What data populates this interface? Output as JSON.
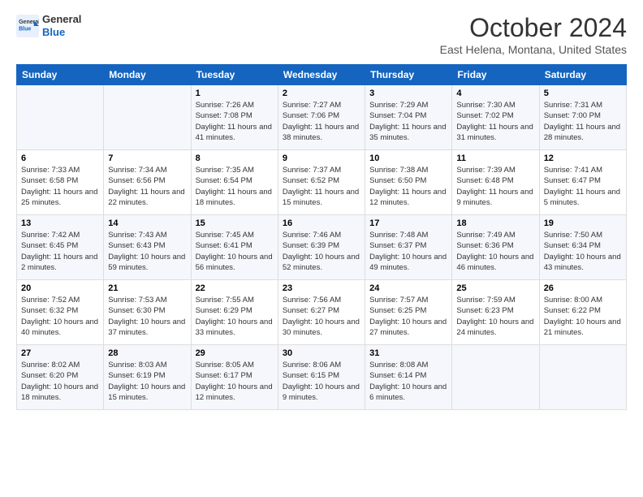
{
  "logo": {
    "line1": "General",
    "line2": "Blue"
  },
  "title": "October 2024",
  "location": "East Helena, Montana, United States",
  "days_header": [
    "Sunday",
    "Monday",
    "Tuesday",
    "Wednesday",
    "Thursday",
    "Friday",
    "Saturday"
  ],
  "weeks": [
    [
      {
        "day": "",
        "sunrise": "",
        "sunset": "",
        "daylight": ""
      },
      {
        "day": "",
        "sunrise": "",
        "sunset": "",
        "daylight": ""
      },
      {
        "day": "1",
        "sunrise": "Sunrise: 7:26 AM",
        "sunset": "Sunset: 7:08 PM",
        "daylight": "Daylight: 11 hours and 41 minutes."
      },
      {
        "day": "2",
        "sunrise": "Sunrise: 7:27 AM",
        "sunset": "Sunset: 7:06 PM",
        "daylight": "Daylight: 11 hours and 38 minutes."
      },
      {
        "day": "3",
        "sunrise": "Sunrise: 7:29 AM",
        "sunset": "Sunset: 7:04 PM",
        "daylight": "Daylight: 11 hours and 35 minutes."
      },
      {
        "day": "4",
        "sunrise": "Sunrise: 7:30 AM",
        "sunset": "Sunset: 7:02 PM",
        "daylight": "Daylight: 11 hours and 31 minutes."
      },
      {
        "day": "5",
        "sunrise": "Sunrise: 7:31 AM",
        "sunset": "Sunset: 7:00 PM",
        "daylight": "Daylight: 11 hours and 28 minutes."
      }
    ],
    [
      {
        "day": "6",
        "sunrise": "Sunrise: 7:33 AM",
        "sunset": "Sunset: 6:58 PM",
        "daylight": "Daylight: 11 hours and 25 minutes."
      },
      {
        "day": "7",
        "sunrise": "Sunrise: 7:34 AM",
        "sunset": "Sunset: 6:56 PM",
        "daylight": "Daylight: 11 hours and 22 minutes."
      },
      {
        "day": "8",
        "sunrise": "Sunrise: 7:35 AM",
        "sunset": "Sunset: 6:54 PM",
        "daylight": "Daylight: 11 hours and 18 minutes."
      },
      {
        "day": "9",
        "sunrise": "Sunrise: 7:37 AM",
        "sunset": "Sunset: 6:52 PM",
        "daylight": "Daylight: 11 hours and 15 minutes."
      },
      {
        "day": "10",
        "sunrise": "Sunrise: 7:38 AM",
        "sunset": "Sunset: 6:50 PM",
        "daylight": "Daylight: 11 hours and 12 minutes."
      },
      {
        "day": "11",
        "sunrise": "Sunrise: 7:39 AM",
        "sunset": "Sunset: 6:48 PM",
        "daylight": "Daylight: 11 hours and 9 minutes."
      },
      {
        "day": "12",
        "sunrise": "Sunrise: 7:41 AM",
        "sunset": "Sunset: 6:47 PM",
        "daylight": "Daylight: 11 hours and 5 minutes."
      }
    ],
    [
      {
        "day": "13",
        "sunrise": "Sunrise: 7:42 AM",
        "sunset": "Sunset: 6:45 PM",
        "daylight": "Daylight: 11 hours and 2 minutes."
      },
      {
        "day": "14",
        "sunrise": "Sunrise: 7:43 AM",
        "sunset": "Sunset: 6:43 PM",
        "daylight": "Daylight: 10 hours and 59 minutes."
      },
      {
        "day": "15",
        "sunrise": "Sunrise: 7:45 AM",
        "sunset": "Sunset: 6:41 PM",
        "daylight": "Daylight: 10 hours and 56 minutes."
      },
      {
        "day": "16",
        "sunrise": "Sunrise: 7:46 AM",
        "sunset": "Sunset: 6:39 PM",
        "daylight": "Daylight: 10 hours and 52 minutes."
      },
      {
        "day": "17",
        "sunrise": "Sunrise: 7:48 AM",
        "sunset": "Sunset: 6:37 PM",
        "daylight": "Daylight: 10 hours and 49 minutes."
      },
      {
        "day": "18",
        "sunrise": "Sunrise: 7:49 AM",
        "sunset": "Sunset: 6:36 PM",
        "daylight": "Daylight: 10 hours and 46 minutes."
      },
      {
        "day": "19",
        "sunrise": "Sunrise: 7:50 AM",
        "sunset": "Sunset: 6:34 PM",
        "daylight": "Daylight: 10 hours and 43 minutes."
      }
    ],
    [
      {
        "day": "20",
        "sunrise": "Sunrise: 7:52 AM",
        "sunset": "Sunset: 6:32 PM",
        "daylight": "Daylight: 10 hours and 40 minutes."
      },
      {
        "day": "21",
        "sunrise": "Sunrise: 7:53 AM",
        "sunset": "Sunset: 6:30 PM",
        "daylight": "Daylight: 10 hours and 37 minutes."
      },
      {
        "day": "22",
        "sunrise": "Sunrise: 7:55 AM",
        "sunset": "Sunset: 6:29 PM",
        "daylight": "Daylight: 10 hours and 33 minutes."
      },
      {
        "day": "23",
        "sunrise": "Sunrise: 7:56 AM",
        "sunset": "Sunset: 6:27 PM",
        "daylight": "Daylight: 10 hours and 30 minutes."
      },
      {
        "day": "24",
        "sunrise": "Sunrise: 7:57 AM",
        "sunset": "Sunset: 6:25 PM",
        "daylight": "Daylight: 10 hours and 27 minutes."
      },
      {
        "day": "25",
        "sunrise": "Sunrise: 7:59 AM",
        "sunset": "Sunset: 6:23 PM",
        "daylight": "Daylight: 10 hours and 24 minutes."
      },
      {
        "day": "26",
        "sunrise": "Sunrise: 8:00 AM",
        "sunset": "Sunset: 6:22 PM",
        "daylight": "Daylight: 10 hours and 21 minutes."
      }
    ],
    [
      {
        "day": "27",
        "sunrise": "Sunrise: 8:02 AM",
        "sunset": "Sunset: 6:20 PM",
        "daylight": "Daylight: 10 hours and 18 minutes."
      },
      {
        "day": "28",
        "sunrise": "Sunrise: 8:03 AM",
        "sunset": "Sunset: 6:19 PM",
        "daylight": "Daylight: 10 hours and 15 minutes."
      },
      {
        "day": "29",
        "sunrise": "Sunrise: 8:05 AM",
        "sunset": "Sunset: 6:17 PM",
        "daylight": "Daylight: 10 hours and 12 minutes."
      },
      {
        "day": "30",
        "sunrise": "Sunrise: 8:06 AM",
        "sunset": "Sunset: 6:15 PM",
        "daylight": "Daylight: 10 hours and 9 minutes."
      },
      {
        "day": "31",
        "sunrise": "Sunrise: 8:08 AM",
        "sunset": "Sunset: 6:14 PM",
        "daylight": "Daylight: 10 hours and 6 minutes."
      },
      {
        "day": "",
        "sunrise": "",
        "sunset": "",
        "daylight": ""
      },
      {
        "day": "",
        "sunrise": "",
        "sunset": "",
        "daylight": ""
      }
    ]
  ]
}
